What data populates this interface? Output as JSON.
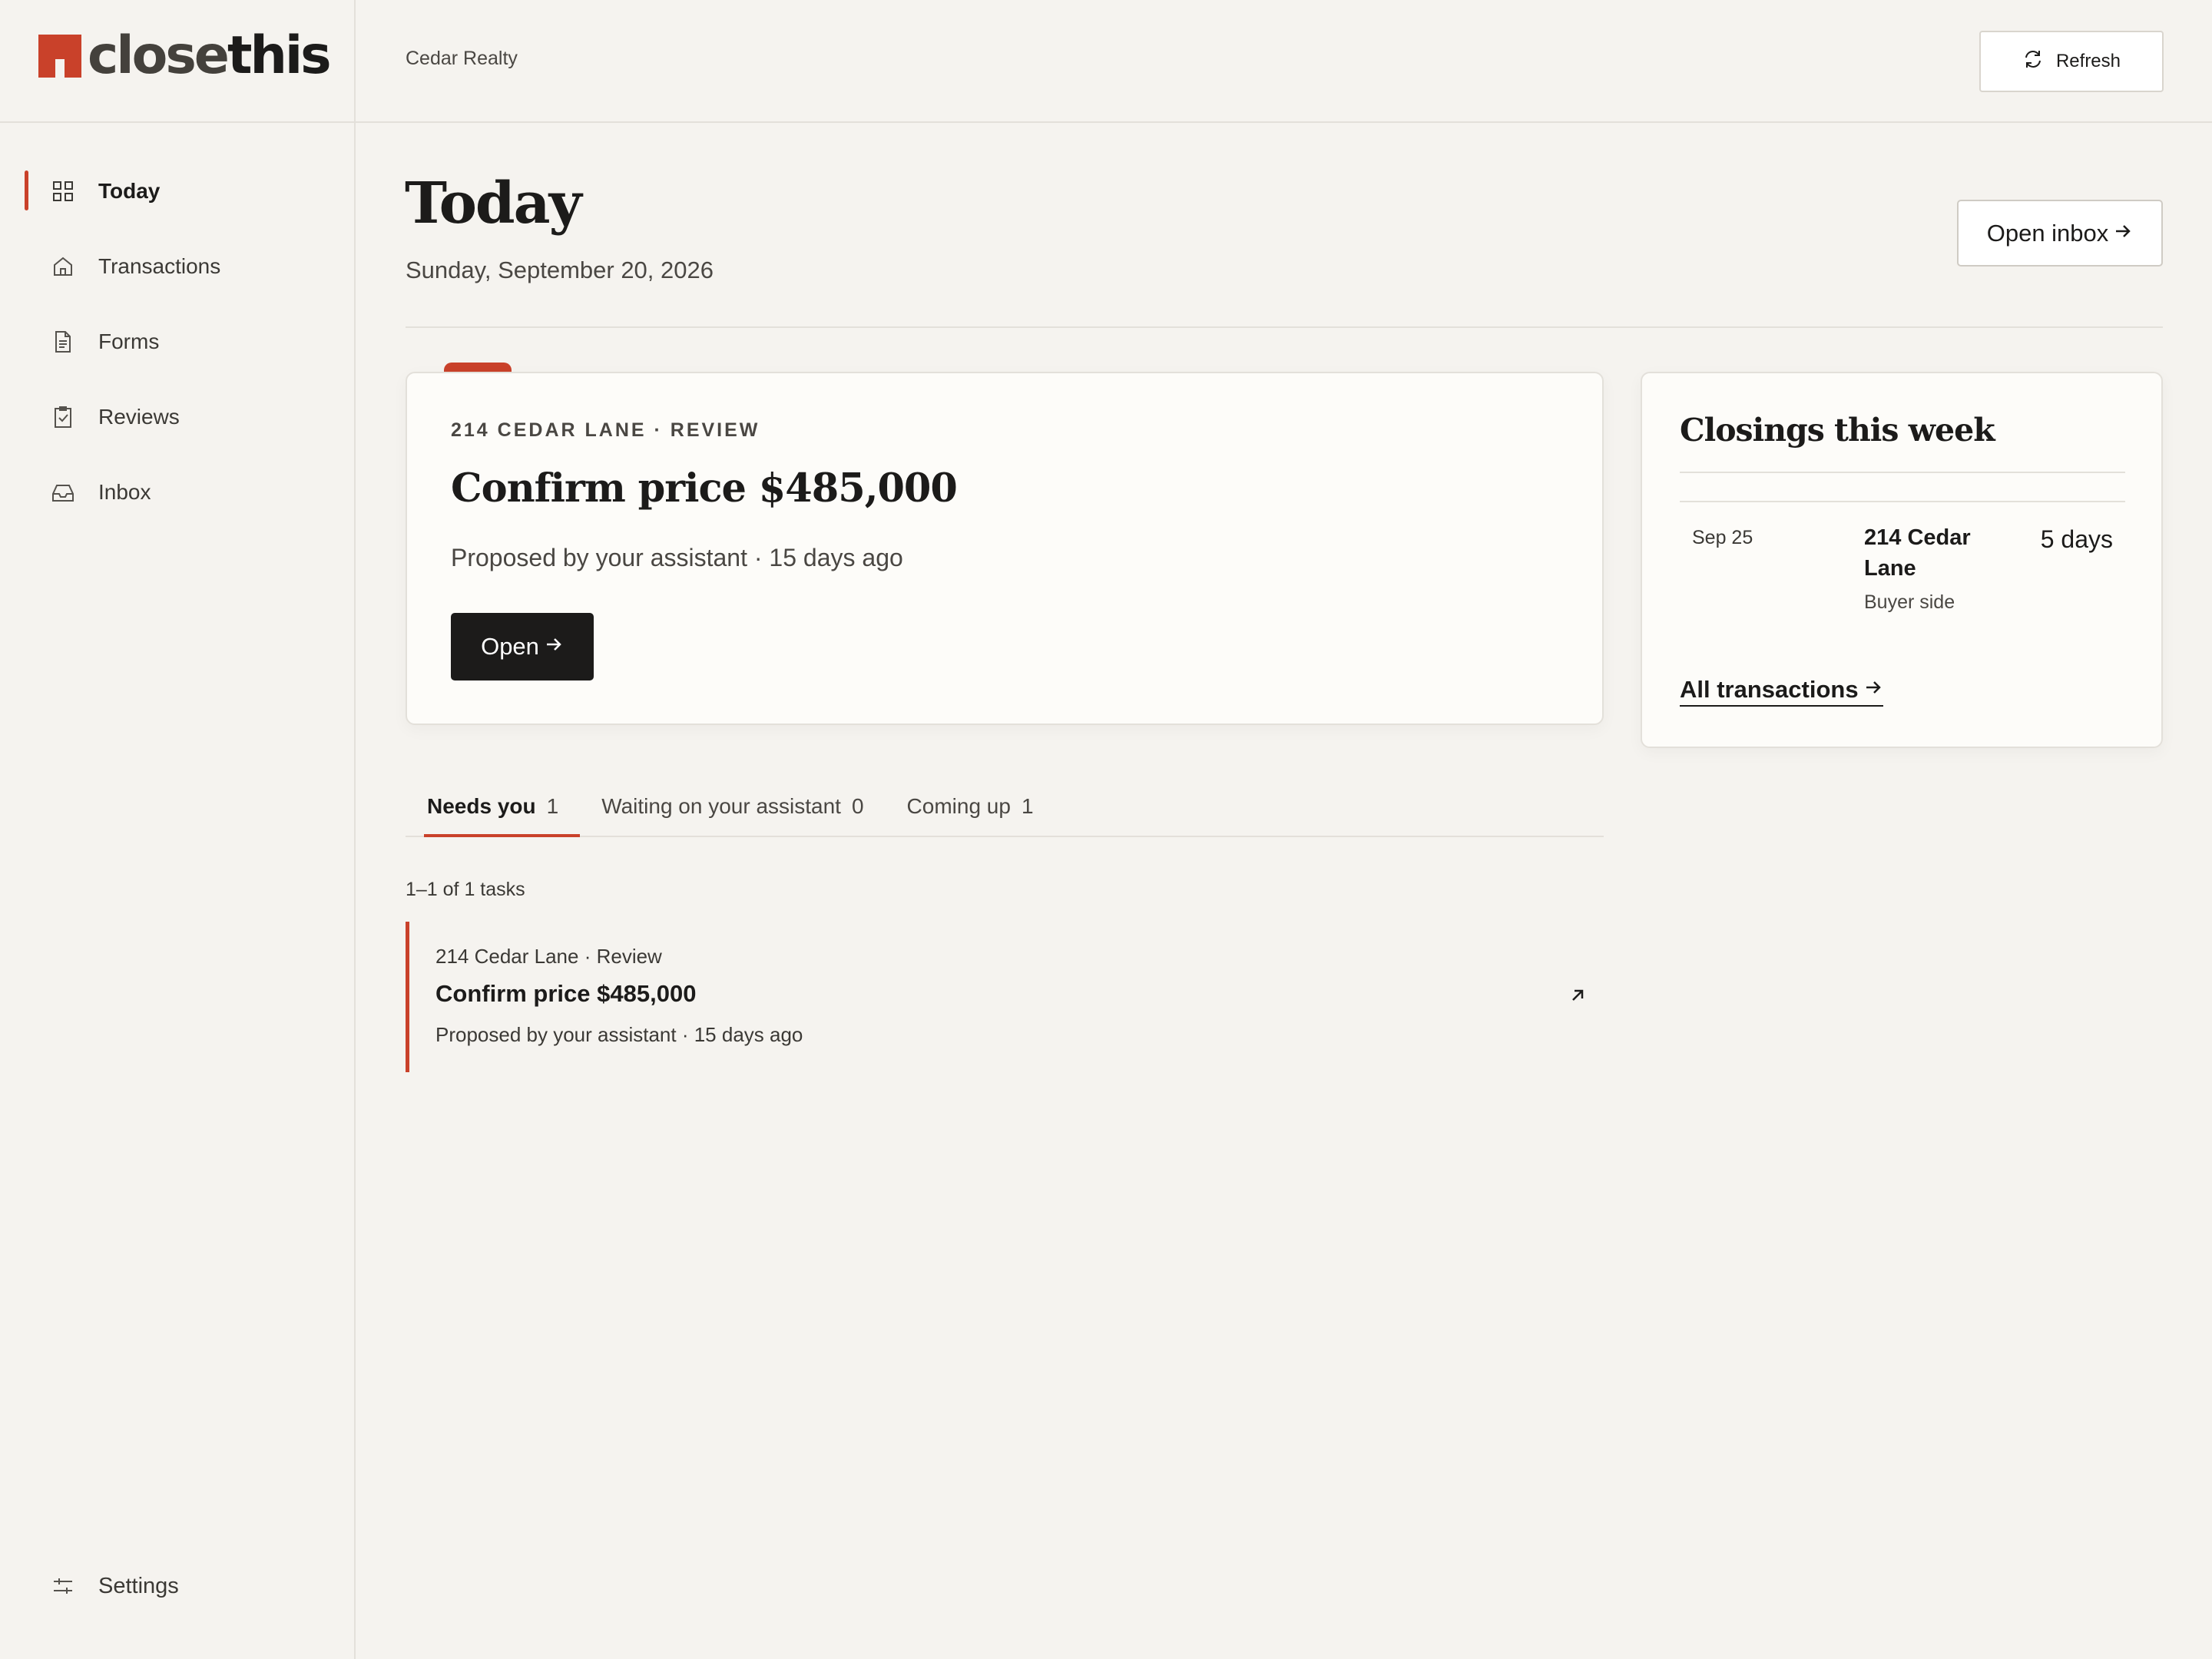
{
  "app": {
    "brand_prefix": "close",
    "brand_suffix": "this",
    "org_name": "Cedar Realty",
    "accent_color": "#c9412a"
  },
  "header": {
    "refresh_label": "Refresh"
  },
  "sidebar": {
    "items": [
      {
        "label": "Today",
        "icon": "grid-icon",
        "active": true
      },
      {
        "label": "Transactions",
        "icon": "house-icon",
        "active": false
      },
      {
        "label": "Forms",
        "icon": "document-icon",
        "active": false
      },
      {
        "label": "Reviews",
        "icon": "clipboard-check-icon",
        "active": false
      },
      {
        "label": "Inbox",
        "icon": "inbox-tray-icon",
        "active": false
      }
    ],
    "settings_label": "Settings"
  },
  "page": {
    "title": "Today",
    "date": "Sunday, September 20, 2026",
    "open_inbox_label": "Open inbox"
  },
  "featured_task": {
    "kicker": "214 CEDAR LANE · REVIEW",
    "title": "Confirm price $485,000",
    "subtitle": "Proposed by your assistant · 15 days ago",
    "open_label": "Open"
  },
  "closings": {
    "title": "Closings this week",
    "rows": [
      {
        "date": "Sep 25",
        "address": "214 Cedar Lane",
        "side": "Buyer side",
        "days": "5 days"
      }
    ],
    "all_link_label": "All transactions"
  },
  "tabs": [
    {
      "label": "Needs you",
      "count": "1",
      "active": true
    },
    {
      "label": "Waiting on your assistant",
      "count": "0",
      "active": false
    },
    {
      "label": "Coming up",
      "count": "1",
      "active": false
    }
  ],
  "task_list": {
    "count_text": "1–1 of 1 tasks",
    "items": [
      {
        "meta": "214 Cedar Lane · Review",
        "title": "Confirm price $485,000",
        "subtitle": "Proposed by your assistant · 15 days ago"
      }
    ]
  }
}
